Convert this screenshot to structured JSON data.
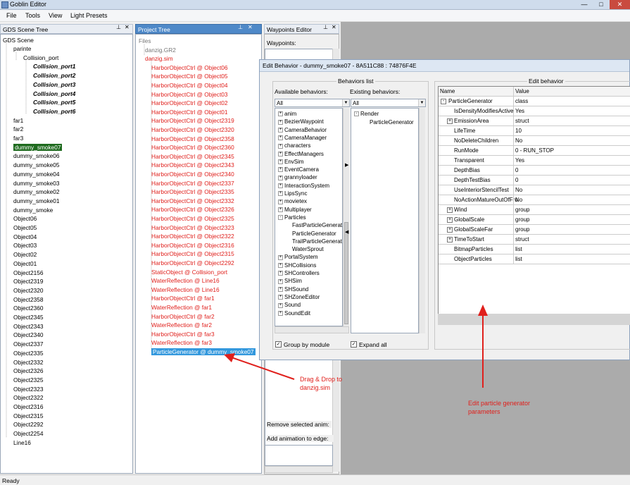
{
  "window": {
    "title": "Goblin Editor",
    "minimize": "—",
    "maximize": "□",
    "close": "✕"
  },
  "menu": [
    "File",
    "Tools",
    "View",
    "Light Presets"
  ],
  "scene_tree": {
    "header": "GDS Scene Tree",
    "root": "GDS Scene",
    "items": [
      {
        "label": "parinte",
        "indent": 1,
        "style": "normal"
      },
      {
        "label": "Collision_port",
        "indent": 2,
        "style": "normal"
      },
      {
        "label": "Collision_port1",
        "indent": 3,
        "style": "bold"
      },
      {
        "label": "Collision_port2",
        "indent": 3,
        "style": "bold"
      },
      {
        "label": "Collision_port3",
        "indent": 3,
        "style": "bold"
      },
      {
        "label": "Collision_port4",
        "indent": 3,
        "style": "bold"
      },
      {
        "label": "Collision_port5",
        "indent": 3,
        "style": "bold"
      },
      {
        "label": "Collision_port6",
        "indent": 3,
        "style": "bold"
      },
      {
        "label": "far1",
        "indent": 1,
        "style": "normal"
      },
      {
        "label": "far2",
        "indent": 1,
        "style": "normal"
      },
      {
        "label": "far3",
        "indent": 1,
        "style": "normal"
      },
      {
        "label": "dummy_smoke07",
        "indent": 1,
        "style": "selected"
      },
      {
        "label": "dummy_smoke06",
        "indent": 1,
        "style": "normal"
      },
      {
        "label": "dummy_smoke05",
        "indent": 1,
        "style": "normal"
      },
      {
        "label": "dummy_smoke04",
        "indent": 1,
        "style": "normal"
      },
      {
        "label": "dummy_smoke03",
        "indent": 1,
        "style": "normal"
      },
      {
        "label": "dummy_smoke02",
        "indent": 1,
        "style": "normal"
      },
      {
        "label": "dummy_smoke01",
        "indent": 1,
        "style": "normal"
      },
      {
        "label": "dummy_smoke",
        "indent": 1,
        "style": "normal"
      },
      {
        "label": "Object06",
        "indent": 1,
        "style": "normal"
      },
      {
        "label": "Object05",
        "indent": 1,
        "style": "normal"
      },
      {
        "label": "Object04",
        "indent": 1,
        "style": "normal"
      },
      {
        "label": "Object03",
        "indent": 1,
        "style": "normal"
      },
      {
        "label": "Object02",
        "indent": 1,
        "style": "normal"
      },
      {
        "label": "Object01",
        "indent": 1,
        "style": "normal"
      },
      {
        "label": "Object2156",
        "indent": 1,
        "style": "normal"
      },
      {
        "label": "Object2319",
        "indent": 1,
        "style": "normal"
      },
      {
        "label": "Object2320",
        "indent": 1,
        "style": "normal"
      },
      {
        "label": "Object2358",
        "indent": 1,
        "style": "normal"
      },
      {
        "label": "Object2360",
        "indent": 1,
        "style": "normal"
      },
      {
        "label": "Object2345",
        "indent": 1,
        "style": "normal"
      },
      {
        "label": "Object2343",
        "indent": 1,
        "style": "normal"
      },
      {
        "label": "Object2340",
        "indent": 1,
        "style": "normal"
      },
      {
        "label": "Object2337",
        "indent": 1,
        "style": "normal"
      },
      {
        "label": "Object2335",
        "indent": 1,
        "style": "normal"
      },
      {
        "label": "Object2332",
        "indent": 1,
        "style": "normal"
      },
      {
        "label": "Object2326",
        "indent": 1,
        "style": "normal"
      },
      {
        "label": "Object2325",
        "indent": 1,
        "style": "normal"
      },
      {
        "label": "Object2323",
        "indent": 1,
        "style": "normal"
      },
      {
        "label": "Object2322",
        "indent": 1,
        "style": "normal"
      },
      {
        "label": "Object2316",
        "indent": 1,
        "style": "normal"
      },
      {
        "label": "Object2315",
        "indent": 1,
        "style": "normal"
      },
      {
        "label": "Object2292",
        "indent": 1,
        "style": "normal"
      },
      {
        "label": "Object2254",
        "indent": 1,
        "style": "normal"
      },
      {
        "label": "Line16",
        "indent": 1,
        "style": "normal"
      }
    ]
  },
  "project_tree": {
    "header": "Project Tree",
    "items": [
      {
        "label": "Files",
        "indent": 0,
        "style": "grey"
      },
      {
        "label": "danzig.GR2",
        "indent": 1,
        "style": "grey"
      },
      {
        "label": "danzig.sim",
        "indent": 1,
        "style": "red"
      },
      {
        "label": "HarborObjectCtrl @ Object06",
        "indent": 2,
        "style": "red"
      },
      {
        "label": "HarborObjectCtrl @ Object05",
        "indent": 2,
        "style": "red"
      },
      {
        "label": "HarborObjectCtrl @ Object04",
        "indent": 2,
        "style": "red"
      },
      {
        "label": "HarborObjectCtrl @ Object03",
        "indent": 2,
        "style": "red"
      },
      {
        "label": "HarborObjectCtrl @ Object02",
        "indent": 2,
        "style": "red"
      },
      {
        "label": "HarborObjectCtrl @ Object01",
        "indent": 2,
        "style": "red"
      },
      {
        "label": "HarborObjectCtrl @ Object2319",
        "indent": 2,
        "style": "red"
      },
      {
        "label": "HarborObjectCtrl @ Object2320",
        "indent": 2,
        "style": "red"
      },
      {
        "label": "HarborObjectCtrl @ Object2358",
        "indent": 2,
        "style": "red"
      },
      {
        "label": "HarborObjectCtrl @ Object2360",
        "indent": 2,
        "style": "red"
      },
      {
        "label": "HarborObjectCtrl @ Object2345",
        "indent": 2,
        "style": "red"
      },
      {
        "label": "HarborObjectCtrl @ Object2343",
        "indent": 2,
        "style": "red"
      },
      {
        "label": "HarborObjectCtrl @ Object2340",
        "indent": 2,
        "style": "red"
      },
      {
        "label": "HarborObjectCtrl @ Object2337",
        "indent": 2,
        "style": "red"
      },
      {
        "label": "HarborObjectCtrl @ Object2335",
        "indent": 2,
        "style": "red"
      },
      {
        "label": "HarborObjectCtrl @ Object2332",
        "indent": 2,
        "style": "red"
      },
      {
        "label": "HarborObjectCtrl @ Object2326",
        "indent": 2,
        "style": "red"
      },
      {
        "label": "HarborObjectCtrl @ Object2325",
        "indent": 2,
        "style": "red"
      },
      {
        "label": "HarborObjectCtrl @ Object2323",
        "indent": 2,
        "style": "red"
      },
      {
        "label": "HarborObjectCtrl @ Object2322",
        "indent": 2,
        "style": "red"
      },
      {
        "label": "HarborObjectCtrl @ Object2316",
        "indent": 2,
        "style": "red"
      },
      {
        "label": "HarborObjectCtrl @ Object2315",
        "indent": 2,
        "style": "red"
      },
      {
        "label": "HarborObjectCtrl @ Object2292",
        "indent": 2,
        "style": "red"
      },
      {
        "label": "StaticObject @ Collision_port",
        "indent": 2,
        "style": "red"
      },
      {
        "label": "WaterReflection @ Line16",
        "indent": 2,
        "style": "red"
      },
      {
        "label": "WaterReflection @ Line16",
        "indent": 2,
        "style": "red"
      },
      {
        "label": "HarborObjectCtrl @ far1",
        "indent": 2,
        "style": "red"
      },
      {
        "label": "WaterReflection @ far1",
        "indent": 2,
        "style": "red"
      },
      {
        "label": "HarborObjectCtrl @ far2",
        "indent": 2,
        "style": "red"
      },
      {
        "label": "WaterReflection @ far2",
        "indent": 2,
        "style": "red"
      },
      {
        "label": "HarborObjectCtrl @ far3",
        "indent": 2,
        "style": "red"
      },
      {
        "label": "WaterReflection @ far3",
        "indent": 2,
        "style": "red"
      },
      {
        "label": "ParticleGenerator @ dummy_smoke07",
        "indent": 2,
        "style": "selected"
      }
    ]
  },
  "waypoints": {
    "header": "Waypoints Editor",
    "label": "Waypoints:",
    "remove_anim": "Remove selected anim:",
    "add_anim": "Add animation to edge:"
  },
  "dialog": {
    "title": "Edit Behavior - dummy_smoke07 - 8A511C88 : 74876F4E",
    "behaviors_list_title": "Behaviors list",
    "available_label": "Available behaviors:",
    "existing_label": "Existing behaviors:",
    "available_filter": "All",
    "existing_filter": "All",
    "available": [
      {
        "label": "anim",
        "indent": 0,
        "expander": "+"
      },
      {
        "label": "BezierWaypoint",
        "indent": 0,
        "expander": "+"
      },
      {
        "label": "CameraBehavior",
        "indent": 0,
        "expander": "+"
      },
      {
        "label": "CameraManager",
        "indent": 0,
        "expander": "+"
      },
      {
        "label": "characters",
        "indent": 0,
        "expander": "+"
      },
      {
        "label": "EffectManagers",
        "indent": 0,
        "expander": "+"
      },
      {
        "label": "EnvSim",
        "indent": 0,
        "expander": "+"
      },
      {
        "label": "EventCamera",
        "indent": 0,
        "expander": "+"
      },
      {
        "label": "grannyloader",
        "indent": 0,
        "expander": "+"
      },
      {
        "label": "InteractionSystem",
        "indent": 0,
        "expander": "+"
      },
      {
        "label": "LipsSync",
        "indent": 0,
        "expander": "+"
      },
      {
        "label": "movietex",
        "indent": 0,
        "expander": "+"
      },
      {
        "label": "Multiplayer",
        "indent": 0,
        "expander": "+"
      },
      {
        "label": "Particles",
        "indent": 0,
        "expander": "-"
      },
      {
        "label": "FastParticleGenerat",
        "indent": 1,
        "expander": ""
      },
      {
        "label": "ParticleGenerator",
        "indent": 1,
        "expander": ""
      },
      {
        "label": "TrailParticleGenerat",
        "indent": 1,
        "expander": ""
      },
      {
        "label": "WaterSprout",
        "indent": 1,
        "expander": ""
      },
      {
        "label": "PortalSystem",
        "indent": 0,
        "expander": "+"
      },
      {
        "label": "SHCollisions",
        "indent": 0,
        "expander": "+"
      },
      {
        "label": "SHControllers",
        "indent": 0,
        "expander": "+"
      },
      {
        "label": "SHSim",
        "indent": 0,
        "expander": "+"
      },
      {
        "label": "SHSound",
        "indent": 0,
        "expander": "+"
      },
      {
        "label": "SHZoneEditor",
        "indent": 0,
        "expander": "+"
      },
      {
        "label": "Sound",
        "indent": 0,
        "expander": "+"
      },
      {
        "label": "SoundEdit",
        "indent": 0,
        "expander": "+"
      }
    ],
    "existing": [
      {
        "label": "Render",
        "indent": 0,
        "expander": "-"
      },
      {
        "label": "ParticleGenerator",
        "indent": 1,
        "expander": ""
      }
    ],
    "group_by_module": "Group by module",
    "expand_all": "Expand all",
    "edit_title": "Edit behavior",
    "grid_name_header": "Name",
    "grid_value_header": "Value",
    "properties": [
      {
        "name": "ParticleGenerator",
        "value": "class",
        "expander": "-",
        "root": true
      },
      {
        "name": "IsDensityModifiesActive",
        "value": "Yes",
        "expander": ""
      },
      {
        "name": "EmissionArea",
        "value": "struct",
        "expander": "+"
      },
      {
        "name": "LifeTime",
        "value": "10",
        "expander": ""
      },
      {
        "name": "NoDeleteChildren",
        "value": "No",
        "expander": ""
      },
      {
        "name": "RunMode",
        "value": "0 - RUN_STOP",
        "expander": ""
      },
      {
        "name": "Transparent",
        "value": "Yes",
        "expander": ""
      },
      {
        "name": "DepthBias",
        "value": "0",
        "expander": ""
      },
      {
        "name": "DepthTestBias",
        "value": "0",
        "expander": ""
      },
      {
        "name": "UseInteriorStencilTest",
        "value": "No",
        "expander": ""
      },
      {
        "name": "NoActionMatureOutOfFru",
        "value": "No",
        "expander": ""
      },
      {
        "name": "Wind",
        "value": "group",
        "expander": "+"
      },
      {
        "name": "GlobalScale",
        "value": "group",
        "expander": "+"
      },
      {
        "name": "GlobalScaleFar",
        "value": "group",
        "expander": "+"
      },
      {
        "name": "TimeToStart",
        "value": "struct",
        "expander": "+"
      },
      {
        "name": "BitmapParticles",
        "value": "list",
        "expander": ""
      },
      {
        "name": "ObjectParticles",
        "value": "list",
        "expander": ""
      }
    ]
  },
  "annotations": {
    "drag_drop_line1": "Drag & Drop to",
    "drag_drop_line2": "danzig.sim",
    "edit_line1": "Edit particle generator",
    "edit_line2": "parameters"
  },
  "status": "Ready",
  "colors": {
    "annotation": "#e0201c",
    "selection_green": "#1f6b1f",
    "selection_blue": "#3398dd"
  }
}
